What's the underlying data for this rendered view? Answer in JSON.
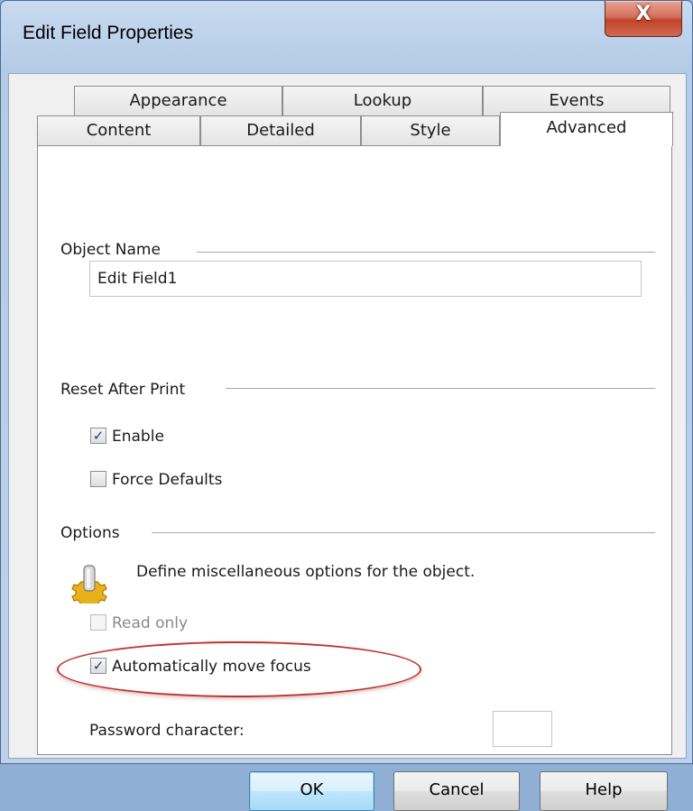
{
  "window": {
    "title": "Edit Field Properties",
    "close_glyph": "X"
  },
  "tabs": {
    "row_top": [
      "Appearance",
      "Lookup",
      "Events"
    ],
    "row_bottom": [
      "Content",
      "Detailed",
      "Style",
      "Advanced"
    ],
    "active": "Advanced"
  },
  "object_name": {
    "label": "Object Name",
    "value": "Edit Field1"
  },
  "reset_after_print": {
    "label": "Reset After Print",
    "enable": {
      "label": "Enable",
      "checked": true
    },
    "force_defaults": {
      "label": "Force Defaults",
      "checked": false
    }
  },
  "options": {
    "label": "Options",
    "icon": "gear-info-icon",
    "description": "Define miscellaneous options for the object.",
    "read_only": {
      "label": "Read only",
      "checked": false,
      "enabled": false
    },
    "auto_focus": {
      "label": "Automatically move focus",
      "checked": true
    },
    "password_label": "Password character:",
    "password_value": ""
  },
  "buttons": {
    "ok": "OK",
    "cancel": "Cancel",
    "help": "Help"
  },
  "colors": {
    "highlight": "#c0322f",
    "checkmark": "#1f3d7a"
  }
}
